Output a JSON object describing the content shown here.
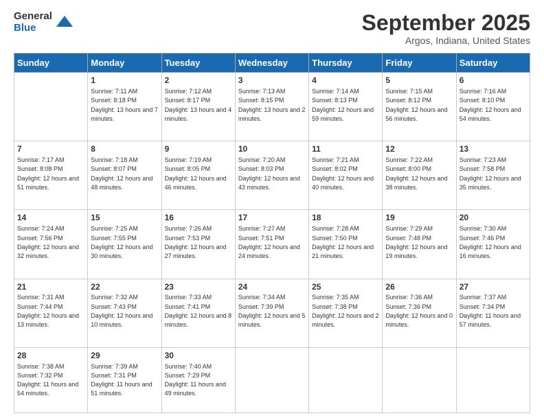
{
  "logo": {
    "general": "General",
    "blue": "Blue"
  },
  "header": {
    "title": "September 2025",
    "subtitle": "Argos, Indiana, United States"
  },
  "days_of_week": [
    "Sunday",
    "Monday",
    "Tuesday",
    "Wednesday",
    "Thursday",
    "Friday",
    "Saturday"
  ],
  "weeks": [
    [
      {
        "day": "",
        "sunrise": "",
        "sunset": "",
        "daylight": ""
      },
      {
        "day": "1",
        "sunrise": "Sunrise: 7:11 AM",
        "sunset": "Sunset: 8:18 PM",
        "daylight": "Daylight: 13 hours and 7 minutes."
      },
      {
        "day": "2",
        "sunrise": "Sunrise: 7:12 AM",
        "sunset": "Sunset: 8:17 PM",
        "daylight": "Daylight: 13 hours and 4 minutes."
      },
      {
        "day": "3",
        "sunrise": "Sunrise: 7:13 AM",
        "sunset": "Sunset: 8:15 PM",
        "daylight": "Daylight: 13 hours and 2 minutes."
      },
      {
        "day": "4",
        "sunrise": "Sunrise: 7:14 AM",
        "sunset": "Sunset: 8:13 PM",
        "daylight": "Daylight: 12 hours and 59 minutes."
      },
      {
        "day": "5",
        "sunrise": "Sunrise: 7:15 AM",
        "sunset": "Sunset: 8:12 PM",
        "daylight": "Daylight: 12 hours and 56 minutes."
      },
      {
        "day": "6",
        "sunrise": "Sunrise: 7:16 AM",
        "sunset": "Sunset: 8:10 PM",
        "daylight": "Daylight: 12 hours and 54 minutes."
      }
    ],
    [
      {
        "day": "7",
        "sunrise": "Sunrise: 7:17 AM",
        "sunset": "Sunset: 8:08 PM",
        "daylight": "Daylight: 12 hours and 51 minutes."
      },
      {
        "day": "8",
        "sunrise": "Sunrise: 7:18 AM",
        "sunset": "Sunset: 8:07 PM",
        "daylight": "Daylight: 12 hours and 48 minutes."
      },
      {
        "day": "9",
        "sunrise": "Sunrise: 7:19 AM",
        "sunset": "Sunset: 8:05 PM",
        "daylight": "Daylight: 12 hours and 46 minutes."
      },
      {
        "day": "10",
        "sunrise": "Sunrise: 7:20 AM",
        "sunset": "Sunset: 8:03 PM",
        "daylight": "Daylight: 12 hours and 43 minutes."
      },
      {
        "day": "11",
        "sunrise": "Sunrise: 7:21 AM",
        "sunset": "Sunset: 8:02 PM",
        "daylight": "Daylight: 12 hours and 40 minutes."
      },
      {
        "day": "12",
        "sunrise": "Sunrise: 7:22 AM",
        "sunset": "Sunset: 8:00 PM",
        "daylight": "Daylight: 12 hours and 38 minutes."
      },
      {
        "day": "13",
        "sunrise": "Sunrise: 7:23 AM",
        "sunset": "Sunset: 7:58 PM",
        "daylight": "Daylight: 12 hours and 35 minutes."
      }
    ],
    [
      {
        "day": "14",
        "sunrise": "Sunrise: 7:24 AM",
        "sunset": "Sunset: 7:56 PM",
        "daylight": "Daylight: 12 hours and 32 minutes."
      },
      {
        "day": "15",
        "sunrise": "Sunrise: 7:25 AM",
        "sunset": "Sunset: 7:55 PM",
        "daylight": "Daylight: 12 hours and 30 minutes."
      },
      {
        "day": "16",
        "sunrise": "Sunrise: 7:26 AM",
        "sunset": "Sunset: 7:53 PM",
        "daylight": "Daylight: 12 hours and 27 minutes."
      },
      {
        "day": "17",
        "sunrise": "Sunrise: 7:27 AM",
        "sunset": "Sunset: 7:51 PM",
        "daylight": "Daylight: 12 hours and 24 minutes."
      },
      {
        "day": "18",
        "sunrise": "Sunrise: 7:28 AM",
        "sunset": "Sunset: 7:50 PM",
        "daylight": "Daylight: 12 hours and 21 minutes."
      },
      {
        "day": "19",
        "sunrise": "Sunrise: 7:29 AM",
        "sunset": "Sunset: 7:48 PM",
        "daylight": "Daylight: 12 hours and 19 minutes."
      },
      {
        "day": "20",
        "sunrise": "Sunrise: 7:30 AM",
        "sunset": "Sunset: 7:46 PM",
        "daylight": "Daylight: 12 hours and 16 minutes."
      }
    ],
    [
      {
        "day": "21",
        "sunrise": "Sunrise: 7:31 AM",
        "sunset": "Sunset: 7:44 PM",
        "daylight": "Daylight: 12 hours and 13 minutes."
      },
      {
        "day": "22",
        "sunrise": "Sunrise: 7:32 AM",
        "sunset": "Sunset: 7:43 PM",
        "daylight": "Daylight: 12 hours and 10 minutes."
      },
      {
        "day": "23",
        "sunrise": "Sunrise: 7:33 AM",
        "sunset": "Sunset: 7:41 PM",
        "daylight": "Daylight: 12 hours and 8 minutes."
      },
      {
        "day": "24",
        "sunrise": "Sunrise: 7:34 AM",
        "sunset": "Sunset: 7:39 PM",
        "daylight": "Daylight: 12 hours and 5 minutes."
      },
      {
        "day": "25",
        "sunrise": "Sunrise: 7:35 AM",
        "sunset": "Sunset: 7:38 PM",
        "daylight": "Daylight: 12 hours and 2 minutes."
      },
      {
        "day": "26",
        "sunrise": "Sunrise: 7:36 AM",
        "sunset": "Sunset: 7:36 PM",
        "daylight": "Daylight: 12 hours and 0 minutes."
      },
      {
        "day": "27",
        "sunrise": "Sunrise: 7:37 AM",
        "sunset": "Sunset: 7:34 PM",
        "daylight": "Daylight: 11 hours and 57 minutes."
      }
    ],
    [
      {
        "day": "28",
        "sunrise": "Sunrise: 7:38 AM",
        "sunset": "Sunset: 7:32 PM",
        "daylight": "Daylight: 11 hours and 54 minutes."
      },
      {
        "day": "29",
        "sunrise": "Sunrise: 7:39 AM",
        "sunset": "Sunset: 7:31 PM",
        "daylight": "Daylight: 11 hours and 51 minutes."
      },
      {
        "day": "30",
        "sunrise": "Sunrise: 7:40 AM",
        "sunset": "Sunset: 7:29 PM",
        "daylight": "Daylight: 11 hours and 49 minutes."
      },
      {
        "day": "",
        "sunrise": "",
        "sunset": "",
        "daylight": ""
      },
      {
        "day": "",
        "sunrise": "",
        "sunset": "",
        "daylight": ""
      },
      {
        "day": "",
        "sunrise": "",
        "sunset": "",
        "daylight": ""
      },
      {
        "day": "",
        "sunrise": "",
        "sunset": "",
        "daylight": ""
      }
    ]
  ]
}
